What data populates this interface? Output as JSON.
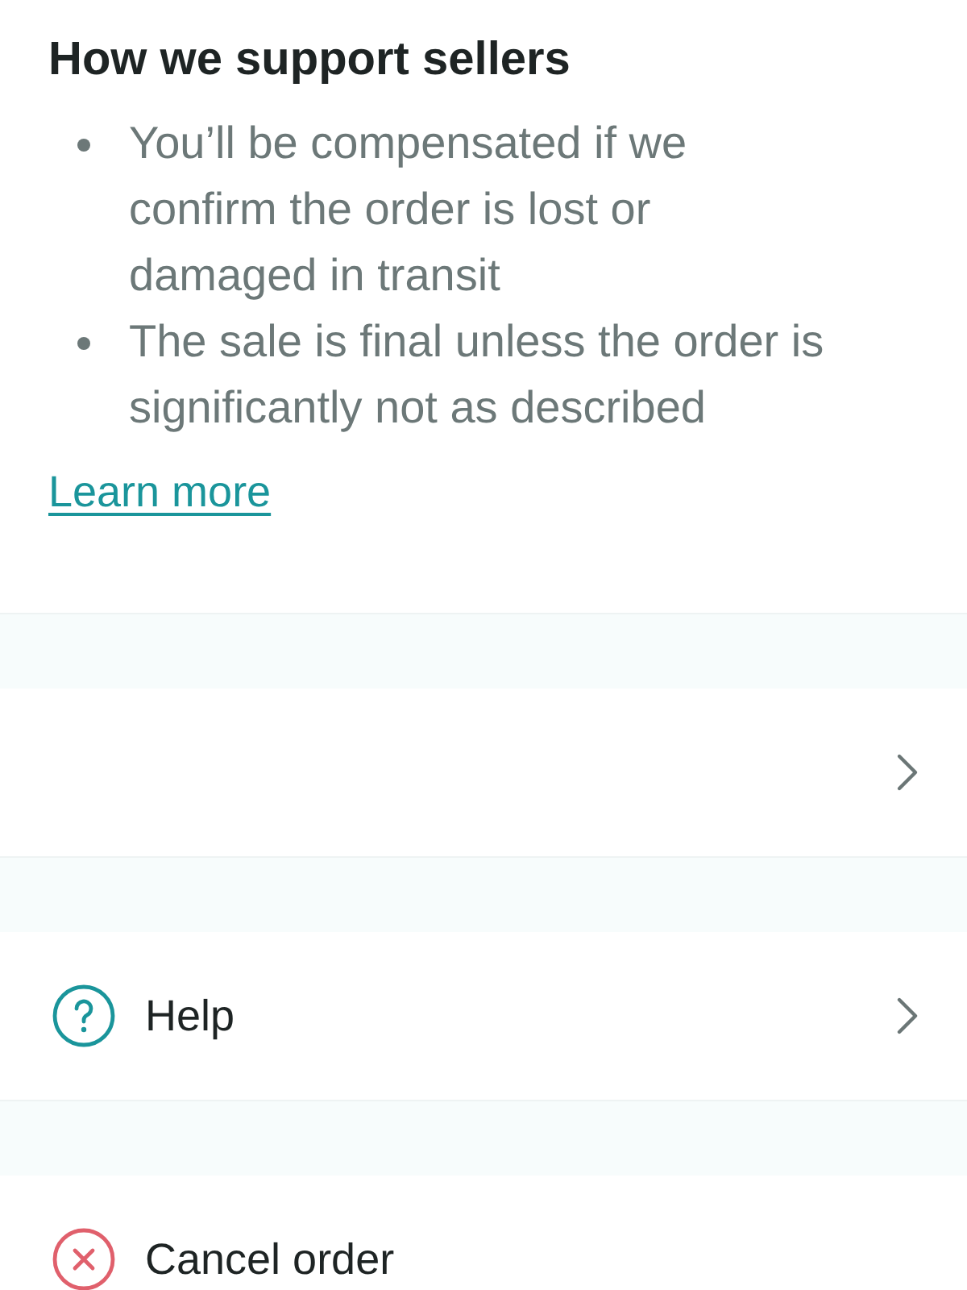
{
  "section": {
    "title": "How we support sellers",
    "bullets": [
      "You’ll be compensated if we confirm the order is lost or damaged in transit",
      "The sale is final unless the order is significantly not as described"
    ],
    "link": "Learn more"
  },
  "rows": [
    {
      "kind": "blank",
      "chevron": true
    },
    {
      "kind": "help",
      "label": "Help",
      "chevron": true
    },
    {
      "kind": "cancel",
      "label": "Cancel order",
      "chevron": false
    }
  ]
}
